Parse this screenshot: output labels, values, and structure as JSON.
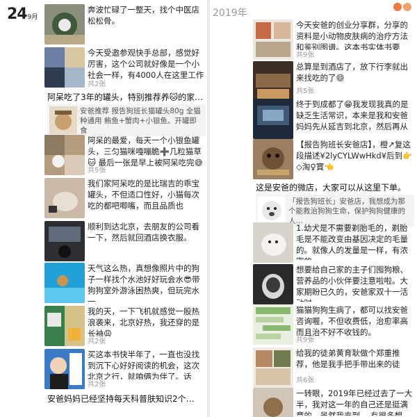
{
  "header": {
    "day": "24",
    "month": "9月",
    "year": "2019年"
  },
  "left": {
    "entries": [
      {
        "text": "奔波忙碌了一整天，找个中医店松松骨。",
        "count": ""
      },
      {
        "text": "今天受邀参观快手总部，感觉好厉害，这个公司就好像是一个小社会一样，有4000人在这里工作😀",
        "count": "共2张"
      },
      {
        "text": "阿呆的最爱，每天一个小银鱼罐头，三匀猫咪嘎嘣脆➕几粒猫草🐱 最后一张是早上被阿呆吃完😅",
        "count": "共5张"
      },
      {
        "text": "我们家阿呆吃的是比瑞吉的乖宝罐头，不但适口性好，小猫每次吃的都吧唧嘴，而且品质也",
        "count": ""
      },
      {
        "text": "顺利到达北京，去朋友的公司看一下，然后就回酒店换衣服。",
        "count": ""
      },
      {
        "text": "天气这么热，真想像照片中的狗子一样找个水池好好玩会水😎带狗狗室外游泳困热爽，但玩完水一",
        "count": ""
      },
      {
        "text": "我的天，一下飞机就感觉一股热浪袭来，北京好热，我还穿的是长袖😩",
        "count": "共2张"
      },
      {
        "text": "买这本书快半年了，一直也没找到沉下心好好阅读的机会，这次北京之行，就咱俩为伴了。话说，我最…",
        "count": "共2张"
      }
    ],
    "section_title": "阿呆吃了3年的罐头，特别推荐养🐱的家…",
    "article_text": "安爸推荐 报告狗班长猫罐头80g 全猫种通用 鲔鱼+蟹肉+小银鱼。开罐即食",
    "bottom_title": "安爸妈妈已经坚持每天科普肤知识2个…"
  },
  "right": {
    "entries": [
      {
        "text": "今天安爸的创业分享群，分享的资料是小动物皮肤病的治疗方法和鉴别图谱。这本书实体书要100多…",
        "count": "共9张"
      },
      {
        "text": "总算是到酒店了，放下行李就出来找吃的了😄",
        "count": "共5张"
      },
      {
        "text": "终于到成都了😁我发现我真的是缺乏生活常识，本来是我和安爸妈妈先从延吉到北京，然后再从北京…",
        "count": ""
      },
      {
        "text": "【报告狗班长安爸店】，橙↗复这段描述¥2lyCYLWwHkd¥后到👉◇淘♀寳👈",
        "count": ""
      },
      {
        "text": "1.幼犬是不需要剃胎毛的，剃胎毛是不能改变由基因决定的毛量的。就像人的发量是一样，有浓密的…",
        "count": ""
      },
      {
        "text": "想要给自己家的主子们囤狗粮、营养品的小伙伴要注意啦啦。大家期盼已久的，安爸家双十一活动时…",
        "count": ""
      },
      {
        "text": "猫猫狗狗生病了，都可以找安爸咨询喔，不但收费低，治愈率高 而且治不好不收钱的。",
        "count": "共9张"
      },
      {
        "text": "给我的徒弟黄育耿做个郑重推荐，他是我手把手带出来的徒弟，不光训大技术精湛，而且对狗狗非…",
        "count": "共6张"
      },
      {
        "text": "一转眼，2019年已经过去了一大半，我对这一年的自己还是挺满意的，虽然我来到… 有很多想做…",
        "count": ""
      }
    ],
    "section_title": "这是安爸的微店，大家可以从这里下单。",
    "article_text": "「报告狗班长」安爸店，我想成为那个能救治狗狗生命，保护狗狗健康的人…"
  },
  "colors": {
    "divider": "#e9e9e9",
    "article_bg": "#f3f3f3",
    "count": "#999999",
    "accent_orange": "#f07a3c"
  }
}
